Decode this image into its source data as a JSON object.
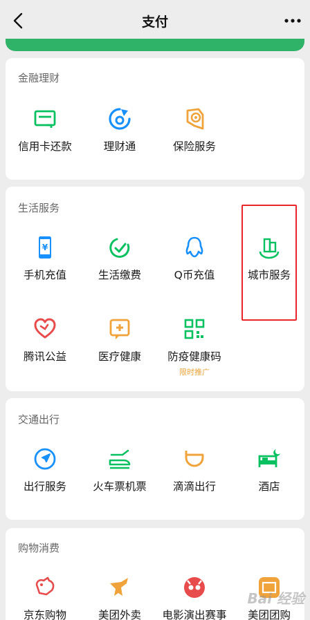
{
  "header": {
    "title": "支付"
  },
  "sections": [
    {
      "title": "金融理财",
      "items": [
        {
          "label": "信用卡还款",
          "icon": "credit-card-icon",
          "color": "#07c160"
        },
        {
          "label": "理财通",
          "icon": "wealth-icon",
          "color": "#1890ff"
        },
        {
          "label": "保险服务",
          "icon": "insurance-icon",
          "color": "#f0a33b"
        }
      ]
    },
    {
      "title": "生活服务",
      "items": [
        {
          "label": "手机充值",
          "icon": "phone-icon",
          "color": "#1890ff"
        },
        {
          "label": "生活缴费",
          "icon": "utility-icon",
          "color": "#07c160"
        },
        {
          "label": "Q币充值",
          "icon": "qq-icon",
          "color": "#1890ff"
        },
        {
          "label": "城市服务",
          "icon": "city-icon",
          "color": "#07c160"
        },
        {
          "label": "腾讯公益",
          "icon": "charity-icon",
          "color": "#e84b4b"
        },
        {
          "label": "医疗健康",
          "icon": "medical-icon",
          "color": "#f0a33b"
        },
        {
          "label": "防疫健康码",
          "icon": "qr-code-icon",
          "color": "#07c160",
          "sublabel": "限时推广"
        }
      ]
    },
    {
      "title": "交通出行",
      "items": [
        {
          "label": "出行服务",
          "icon": "navigation-icon",
          "color": "#1890ff"
        },
        {
          "label": "火车票机票",
          "icon": "train-icon",
          "color": "#07c160"
        },
        {
          "label": "滴滴出行",
          "icon": "didi-icon",
          "color": "#f0a33b"
        },
        {
          "label": "酒店",
          "icon": "hotel-icon",
          "color": "#07c160"
        }
      ]
    },
    {
      "title": "购物消费",
      "items": [
        {
          "label": "京东购物",
          "icon": "jd-icon",
          "color": "#e84b4b"
        },
        {
          "label": "美团外卖",
          "icon": "kangaroo-icon",
          "color": "#f0a33b"
        },
        {
          "label": "电影演出赛事",
          "icon": "cat-eye-icon",
          "color": "#e84b4b"
        },
        {
          "label": "美团团购",
          "icon": "meituan-icon",
          "color": "#f0a33b"
        }
      ]
    }
  ],
  "watermark": "Bai 经验"
}
